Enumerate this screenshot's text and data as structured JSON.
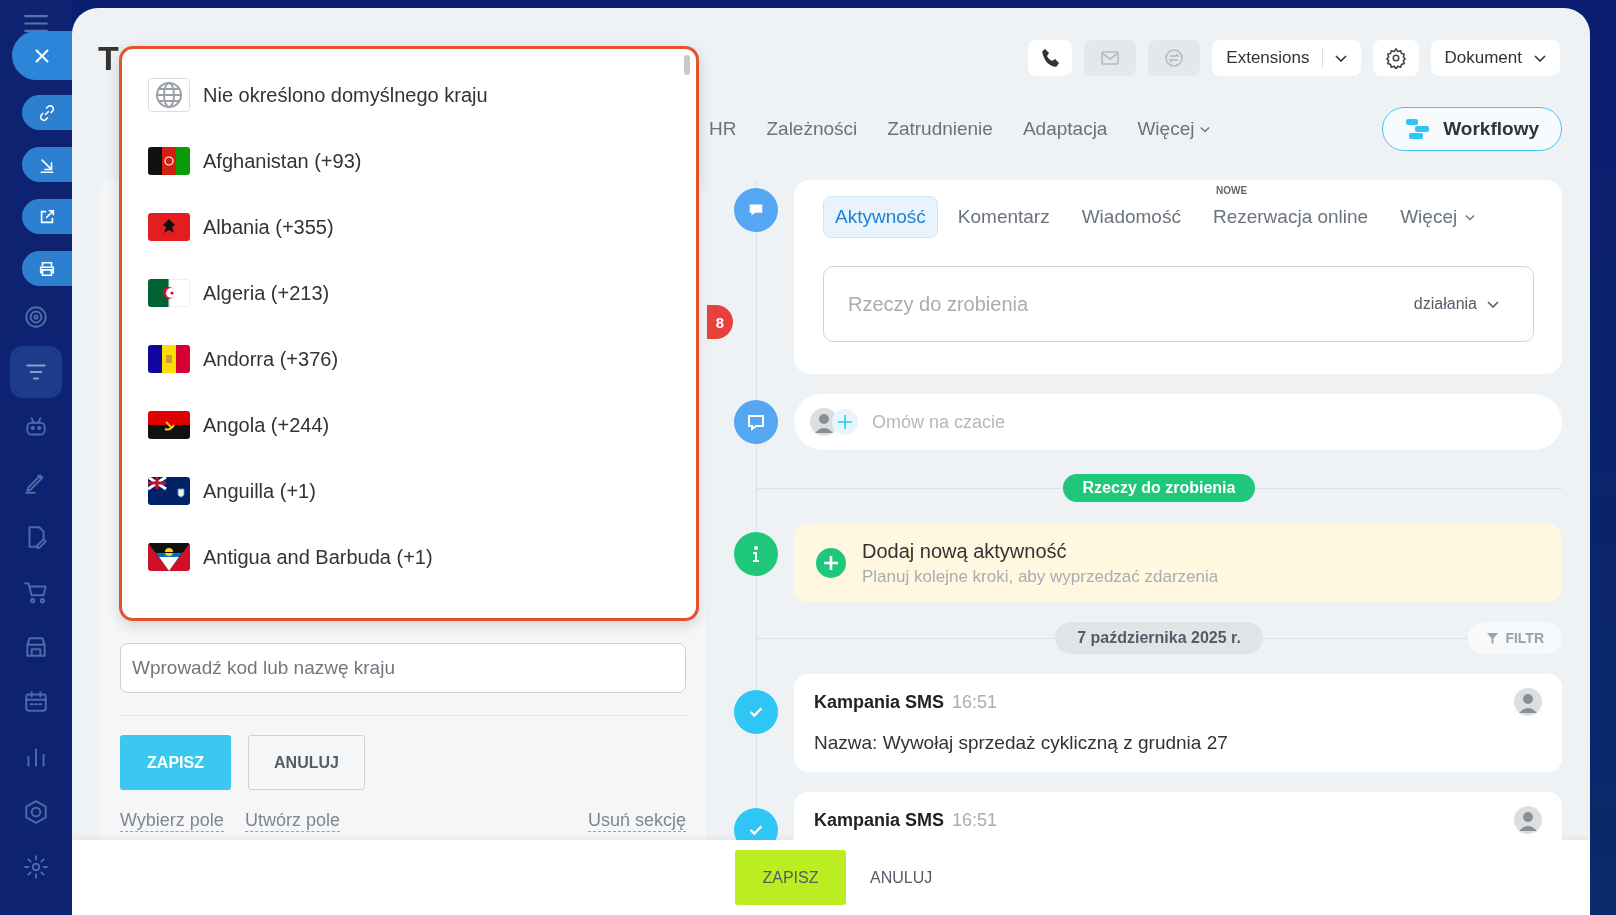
{
  "page": {
    "title": "T"
  },
  "sidebar": {
    "items": [
      {
        "kind": "target",
        "selected": false
      },
      {
        "kind": "funnel",
        "selected": true
      },
      {
        "kind": "robot",
        "selected": false
      },
      {
        "kind": "pen",
        "selected": false
      },
      {
        "kind": "document",
        "selected": false
      },
      {
        "kind": "cart",
        "selected": false
      },
      {
        "kind": "store",
        "selected": false
      },
      {
        "kind": "calendar",
        "selected": false
      },
      {
        "kind": "chart",
        "selected": false
      },
      {
        "kind": "hexagon",
        "selected": false
      },
      {
        "kind": "gear",
        "selected": false
      }
    ]
  },
  "toolbar": {
    "buttons": [
      {
        "kind": "phone",
        "disabled": false
      },
      {
        "kind": "mail",
        "disabled": true
      },
      {
        "kind": "chat",
        "disabled": true
      }
    ],
    "extensions_button": "Extensions",
    "document_button": "Dokument"
  },
  "tabs": [
    {
      "label": "HR",
      "selected": false
    },
    {
      "label": "Zależności",
      "selected": false
    },
    {
      "label": "Zatrudnienie",
      "selected": false
    },
    {
      "label": "Adaptacja",
      "selected": false
    },
    {
      "label": "Więcej",
      "selected": false,
      "kind": "more"
    }
  ],
  "workflow_button": "Workflowy",
  "country_dropdown": {
    "items": [
      {
        "kind": "none",
        "label": "Nie określono domyślnego kraju"
      },
      {
        "kind": "flag",
        "label": "Afghanistan (+93)"
      },
      {
        "kind": "flag",
        "label": "Albania (+355)"
      },
      {
        "kind": "flag",
        "label": "Algeria (+213)"
      },
      {
        "kind": "flag",
        "label": "Andorra (+376)"
      },
      {
        "kind": "flag",
        "label": "Angola (+244)"
      },
      {
        "kind": "flag",
        "label": "Anguilla (+1)"
      },
      {
        "kind": "flag",
        "label": "Antigua and Barbuda (+1)"
      }
    ]
  },
  "notification_badge": "8",
  "default_country": {
    "placeholder": "Wprowadź kod lub nazwę kraju"
  },
  "form_buttons": {
    "save": "ZAPISZ",
    "cancel": "ANULUJ"
  },
  "form_links": [
    "Wybierz pole",
    "Utwórz pole",
    "Usuń sekcję"
  ],
  "composer": {
    "tabs": [
      {
        "label": "Aktywność",
        "selected": true
      },
      {
        "label": "Komentarz",
        "selected": false
      },
      {
        "label": "Wiadomość",
        "selected": false
      },
      {
        "label": "Rezerwacja online",
        "selected": false,
        "badge": "NOWE"
      },
      {
        "label": "Więcej",
        "selected": false,
        "kind": "more"
      }
    ],
    "field": {
      "placeholder": "Rzeczy do zrobienia"
    },
    "actions_menu": "działania"
  },
  "chat": {
    "placeholder": "Omów na czacie"
  },
  "todo_label": "Rzeczy do zrobienia",
  "add_activity": {
    "title": "Dodaj nową aktywność",
    "subtitle": "Planuj kolejne kroki, aby wyprzedzać zdarzenia"
  },
  "date_label": "7 października 2025 r.",
  "filter_button": "FILTR",
  "history": [
    {
      "title": "Kampania SMS",
      "time": "16:51",
      "text": "Nazwa: Wywołaj sprzedaż cykliczną z grudnia 27"
    },
    {
      "title": "Kampania SMS",
      "time": "16:51"
    }
  ],
  "footer": {
    "save": "ZAPISZ",
    "cancel": "ANULUJ"
  }
}
